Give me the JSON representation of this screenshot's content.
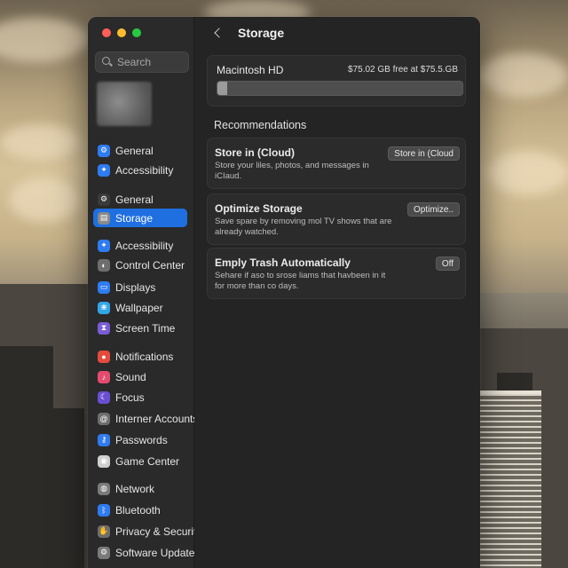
{
  "window": {
    "sidebar": {
      "search_placeholder": "Search",
      "items": [
        {
          "label": "General",
          "icon": "gear-icon",
          "color": "#2f7bf0",
          "active": false
        },
        {
          "label": "Accessibility",
          "icon": "accessibility-icon",
          "color": "#2f7bf0",
          "active": false
        },
        {
          "label": "General",
          "icon": "gear-icon",
          "color": "#3a3a3a",
          "active": false
        },
        {
          "label": "Storage",
          "icon": "storage-icon",
          "color": "#8a8a8a",
          "active": true
        },
        {
          "label": "Accessibility",
          "icon": "accessibility-icon",
          "color": "#2f7bf0",
          "active": false
        },
        {
          "label": "Control Center",
          "icon": "control-center-icon",
          "color": "#6e6e6e",
          "active": false
        },
        {
          "label": "Displays",
          "icon": "display-icon",
          "color": "#2f7bf0",
          "active": false
        },
        {
          "label": "Wallpaper",
          "icon": "wallpaper-icon",
          "color": "#33a6e8",
          "active": false
        },
        {
          "label": "Screen Time",
          "icon": "hourglass-icon",
          "color": "#7a5cd6",
          "active": false
        },
        {
          "label": "Notifications",
          "icon": "bell-icon",
          "color": "#e54b3c",
          "active": false
        },
        {
          "label": "Sound",
          "icon": "speaker-icon",
          "color": "#e54b6e",
          "active": false
        },
        {
          "label": "Focus",
          "icon": "moon-icon",
          "color": "#6a4fd3",
          "active": false
        },
        {
          "label": "Interner Accounts",
          "icon": "at-icon",
          "color": "#6e6e6e",
          "active": false
        },
        {
          "label": "Passwords",
          "icon": "key-icon",
          "color": "#2f7bf0",
          "active": false
        },
        {
          "label": "Game Center",
          "icon": "game-center-icon",
          "color": "#cfcfcf",
          "active": false
        },
        {
          "label": "Network",
          "icon": "globe-icon",
          "color": "#7a7a7a",
          "active": false
        },
        {
          "label": "Bluetooth",
          "icon": "bluetooth-icon",
          "color": "#2f7bf0",
          "active": false
        },
        {
          "label": "Privacy & Security",
          "icon": "hand-icon",
          "color": "#6e6e6e",
          "active": false
        },
        {
          "label": "Software Update",
          "icon": "gear-icon",
          "color": "#7a7a7a",
          "active": false
        }
      ]
    },
    "content": {
      "title": "Storage",
      "disk": {
        "name": "Macintosh HD",
        "free_text": "$75.02 GB free at $75.5.GB",
        "used_fraction": 0.04
      },
      "recommendations_title": "Recommendations",
      "recommendations": [
        {
          "title": "Store in (Cloud)",
          "description": "Store your liles, photos, and messages in iCIaud.",
          "button": "Store in (Cloud"
        },
        {
          "title": "Optimize Storage",
          "description": "Save spare by removing mol TV shows that are already watched.",
          "button": "Optimize.."
        },
        {
          "title": "Emply Trash Automatically",
          "description": "Sehare if aso to srose liams that havbeen in it for more than co days.",
          "button": "Off"
        }
      ]
    }
  }
}
